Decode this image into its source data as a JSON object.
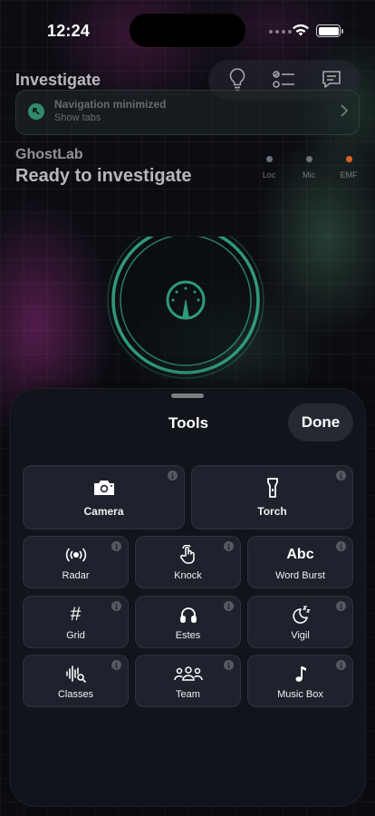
{
  "status_bar": {
    "time": "12:24"
  },
  "header": {
    "title": "Investigate",
    "icons": [
      "lightbulb-icon",
      "checklist-icon",
      "chat-icon"
    ]
  },
  "nav_banner": {
    "title": "Navigation minimized",
    "subtitle": "Show tabs"
  },
  "session": {
    "app_name": "GhostLab",
    "status": "Ready to investigate",
    "sensors": [
      {
        "label": "Loc",
        "color": "#6b6f78"
      },
      {
        "label": "Mic",
        "color": "#6b6f78"
      },
      {
        "label": "EMF",
        "color": "#e0621f"
      }
    ],
    "accent_color": "#2f9a78"
  },
  "sheet": {
    "title": "Tools",
    "done_label": "Done",
    "tools": [
      {
        "label": "Camera",
        "icon": "camera-icon"
      },
      {
        "label": "Torch",
        "icon": "flashlight-icon"
      },
      {
        "label": "Radar",
        "icon": "radar-icon"
      },
      {
        "label": "Knock",
        "icon": "hand-tap-icon"
      },
      {
        "label": "Word Burst",
        "icon": "abc-icon",
        "icon_text": "Abc"
      },
      {
        "label": "Grid",
        "icon": "grid-icon",
        "icon_text": "#"
      },
      {
        "label": "Estes",
        "icon": "headphones-icon"
      },
      {
        "label": "Vigil",
        "icon": "moon-zzz-icon"
      },
      {
        "label": "Classes",
        "icon": "waveform-search-icon"
      },
      {
        "label": "Team",
        "icon": "team-icon"
      },
      {
        "label": "Music Box",
        "icon": "music-note-icon"
      }
    ],
    "info_glyph": "i"
  }
}
